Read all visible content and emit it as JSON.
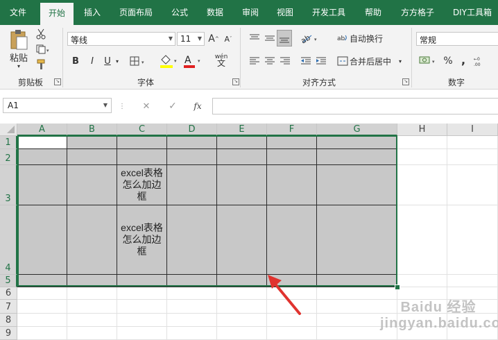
{
  "tabs": [
    "文件",
    "开始",
    "插入",
    "页面布局",
    "公式",
    "数据",
    "审阅",
    "视图",
    "开发工具",
    "帮助",
    "方方格子",
    "DIY工具箱"
  ],
  "ribbon": {
    "clipboard": {
      "paste_label": "粘贴",
      "group_label": "剪贴板"
    },
    "font": {
      "font_name": "等线",
      "font_size": "11",
      "bold": "B",
      "italic": "I",
      "underline": "U",
      "grow": "A",
      "shrink": "A",
      "font_color_letter": "A",
      "phonetic": "wén",
      "group_label": "字体"
    },
    "alignment": {
      "wrap_text": "自动换行",
      "merge_center": "合并后居中",
      "group_label": "对齐方式"
    },
    "number": {
      "format": "常规",
      "percent": "%",
      "comma": ",",
      "group_label": "数字"
    }
  },
  "formula_bar": {
    "name_box": "A1",
    "fx": "fx",
    "formula": ""
  },
  "grid": {
    "columns": [
      "A",
      "B",
      "C",
      "D",
      "E",
      "F",
      "G",
      "H",
      "I"
    ],
    "rows": [
      "1",
      "2",
      "3",
      "4",
      "5",
      "6",
      "7",
      "8",
      "9"
    ],
    "selected_range": "A1:G5",
    "cells": {
      "C3": "excel表格\n怎么加边\n框",
      "C4": "excel表格\n怎么加边\n框"
    }
  },
  "colors": {
    "accent": "#217346",
    "selection_fill": "#c8c8c8",
    "arrow": "#e0332f"
  },
  "watermark": "Baidu 经验  jingyan.baidu.com"
}
